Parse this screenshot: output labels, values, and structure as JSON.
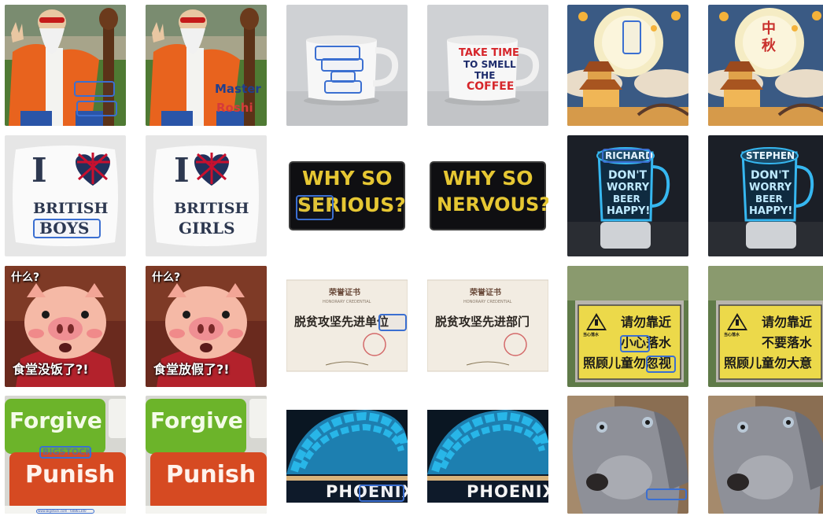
{
  "rows": [
    {
      "pairs": [
        {
          "before": {
            "labels": []
          },
          "after": {
            "labels": [
              "Master",
              "Roshi"
            ]
          }
        },
        {
          "before": {
            "labels": []
          },
          "after": {
            "labels": [
              "TAKE TIME",
              "TO SMELL",
              "THE",
              "COFFEE"
            ]
          }
        },
        {
          "before": {
            "labels": []
          },
          "after": {
            "labels": [
              "中",
              "秋"
            ]
          }
        }
      ]
    },
    {
      "pairs": [
        {
          "before": {
            "labels": [
              "I",
              "BRITISH",
              "BOYS"
            ]
          },
          "after": {
            "labels": [
              "I",
              "BRITISH",
              "GIRLS"
            ]
          }
        },
        {
          "before": {
            "labels": [
              "WHY SO",
              "SERIOUS?"
            ]
          },
          "after": {
            "labels": [
              "WHY SO",
              "NERVOUS?"
            ]
          }
        },
        {
          "before": {
            "labels": [
              "RICHARD",
              "DON'T",
              "WORRY",
              "BEER",
              "HAPPY!"
            ]
          },
          "after": {
            "labels": [
              "STEPHEN",
              "DON'T",
              "WORRY",
              "BEER",
              "HAPPY!"
            ]
          }
        }
      ]
    },
    {
      "pairs": [
        {
          "before": {
            "labels": [
              "什么?",
              "食堂没饭了?!"
            ]
          },
          "after": {
            "labels": [
              "什么?",
              "食堂放假了?!"
            ]
          }
        },
        {
          "before": {
            "labels": [
              "荣誉证书",
              "HONORARY CREDENTIAL",
              "脱贫攻坚先进单位"
            ]
          },
          "after": {
            "labels": [
              "荣誉证书",
              "HONORARY CREDENTIAL",
              "脱贫攻坚先进部门"
            ]
          }
        },
        {
          "before": {
            "labels": [
              "请勿靠近",
              "小心落水",
              "照顾儿童勿忽视",
              "当心落水"
            ]
          },
          "after": {
            "labels": [
              "请勿靠近",
              "不要落水",
              "照顾儿童勿大意",
              "当心落水"
            ]
          }
        }
      ]
    },
    {
      "pairs": [
        {
          "before": {
            "labels": [
              "Forgive",
              "Punish",
              "BIGSTOCK",
              "www.bigstock.com · 60861340"
            ]
          },
          "after": {
            "labels": [
              "Forgive",
              "Punish"
            ]
          }
        },
        {
          "before": {
            "labels": [
              "PHOENIX"
            ]
          },
          "after": {
            "labels": [
              "PHOENIX"
            ]
          }
        },
        {
          "before": {
            "labels": []
          },
          "after": {
            "labels": []
          }
        }
      ]
    }
  ],
  "colors": {
    "bbox": "#3b6fd1",
    "robe_orange": "#e8631e",
    "grass": "#5f8d3a",
    "mug_red": "#d6262b",
    "mug_navy": "#1d2b6b",
    "patch_gold": "#e6c733",
    "neon_blue": "#36b7f0",
    "pig_pink": "#f5b9a6",
    "sign_yellow": "#ecd94a",
    "key_green": "#6cb42a",
    "key_red": "#d64a22",
    "dome_cyan": "#28b6e8",
    "dog_gray": "#8e9098"
  }
}
